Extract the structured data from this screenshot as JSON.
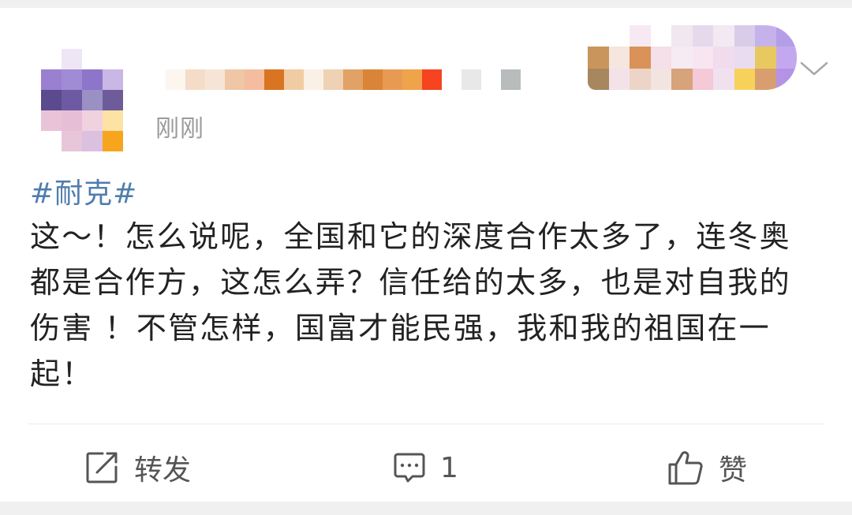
{
  "post": {
    "timestamp": "刚刚",
    "topic": "#耐克#",
    "content": "这～！怎么说呢，全国和它的深度合作太多了，连冬奥都是合作方，这怎么弄？信任给的太多，也是对自我的伤害 ！不管怎样，国富才能民强，我和我的祖国在一起！"
  },
  "actions": {
    "repost_label": "转发",
    "comment_count": "1",
    "like_label": "赞"
  },
  "icons": {
    "repost": "repost-icon",
    "comment": "comment-icon",
    "like": "thumbs-up-icon",
    "more": "chevron-down-icon"
  },
  "colors": {
    "topic_link": "#4f7cae",
    "timestamp": "#9b9b9b",
    "text": "#222222",
    "icon": "#555555"
  }
}
